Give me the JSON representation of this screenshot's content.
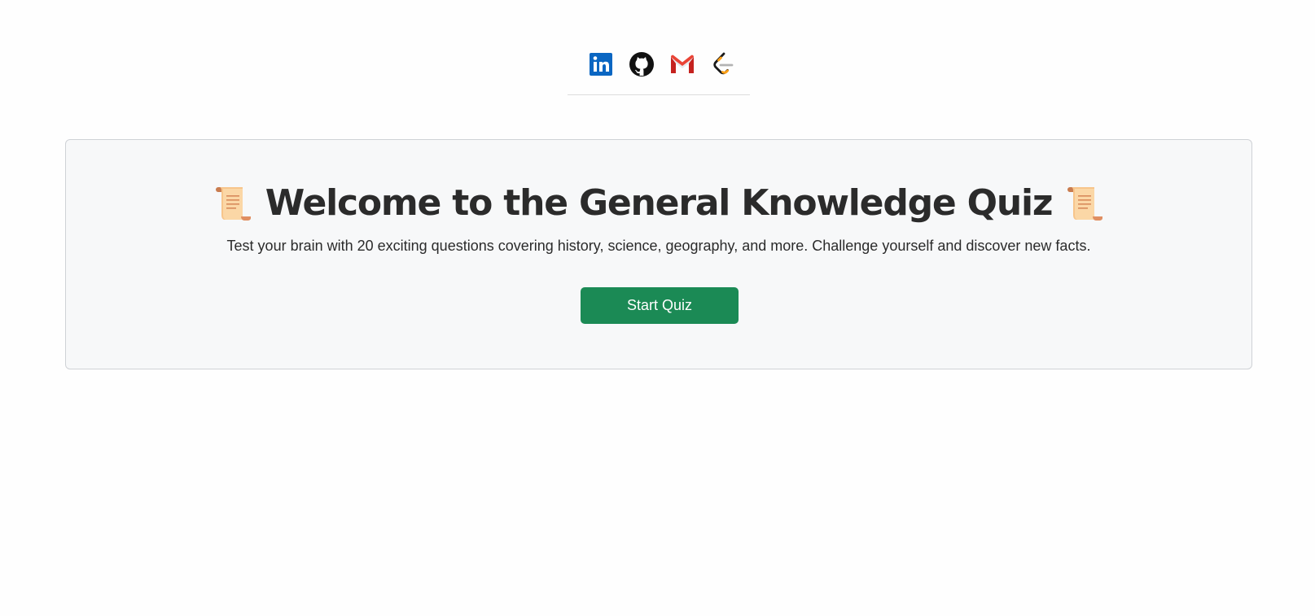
{
  "social": {
    "links": [
      {
        "icon": "linkedin-icon",
        "color": "#0a66c2"
      },
      {
        "icon": "github-icon",
        "color": "#111111"
      },
      {
        "icon": "gmail-icon",
        "color": "#ea4335"
      },
      {
        "icon": "leetcode-icon",
        "color": "#ffa116"
      }
    ]
  },
  "hero": {
    "title": "Welcome to the General Knowledge Quiz",
    "title_icon": "scroll-emoji-icon",
    "subtitle": "Test your brain with 20 exciting questions covering history, science, geography, and more. Challenge yourself and discover new facts.",
    "start_button_label": "Start Quiz",
    "button_color": "#1b8a55",
    "card_background": "#f7f8f9"
  }
}
